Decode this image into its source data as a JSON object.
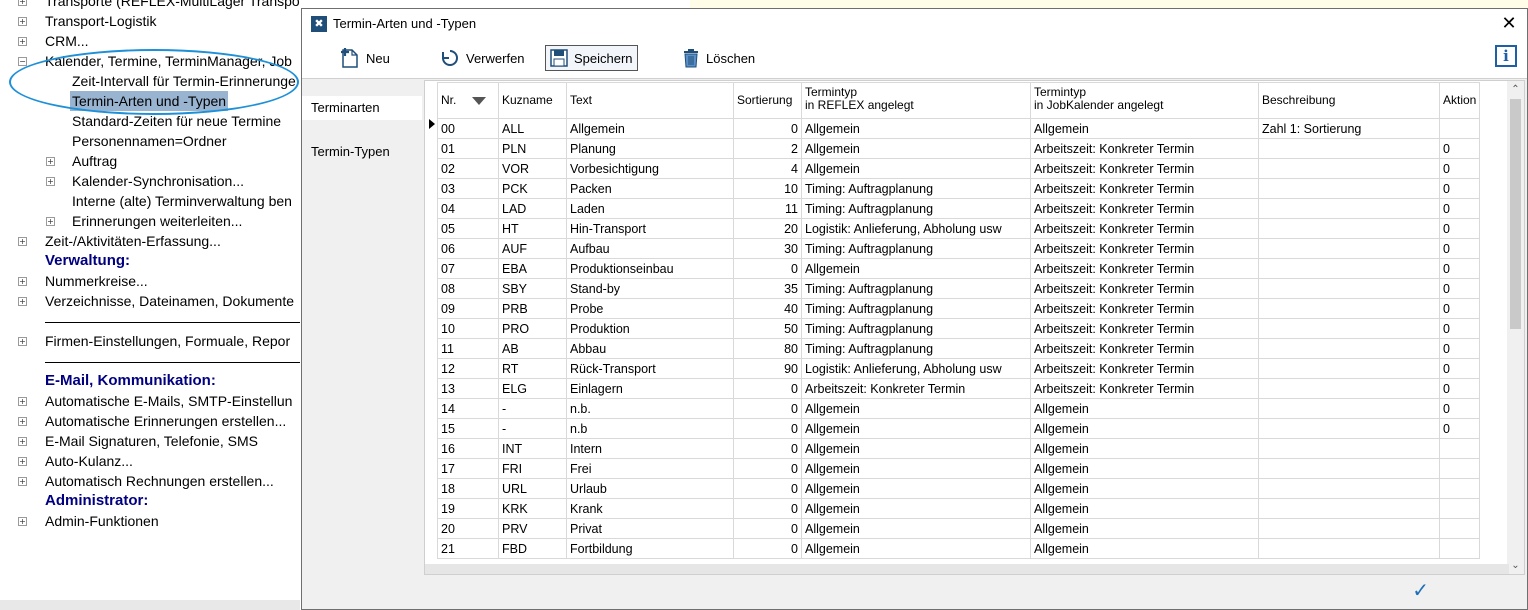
{
  "tree": {
    "items": [
      {
        "label": "Transporte (REFLEX-MultiLager Transporte)",
        "expander": "+"
      },
      {
        "label": "Transport-Logistik",
        "expander": "+"
      },
      {
        "label": "CRM...",
        "expander": "+"
      },
      {
        "label": "Kalender, Termine, TerminManager, Job",
        "expander": "−"
      },
      {
        "label": "Zeit-Intervall für Termin-Erinnerunge",
        "expander": ""
      },
      {
        "label": "Termin-Arten und -Typen",
        "expander": ""
      },
      {
        "label": "Standard-Zeiten für neue Termine",
        "expander": ""
      },
      {
        "label": "Personennamen=Ordner",
        "expander": ""
      },
      {
        "label": "Auftrag",
        "expander": "+"
      },
      {
        "label": "Kalender-Synchronisation...",
        "expander": "+"
      },
      {
        "label": "Interne (alte) Terminverwaltung ben",
        "expander": ""
      },
      {
        "label": "Erinnerungen weiterleiten...",
        "expander": "+"
      },
      {
        "label": "Zeit-/Aktivitäten-Erfassung...",
        "expander": "+"
      },
      {
        "label": "Verwaltung:",
        "expander": ""
      },
      {
        "label": "Nummerkreise...",
        "expander": "+"
      },
      {
        "label": "Verzeichnisse, Dateinamen, Dokumente",
        "expander": "+"
      },
      {
        "label": "Firmen-Einstellungen, Formuale, Repor",
        "expander": "+"
      },
      {
        "label": "E-Mail, Kommunikation:",
        "expander": ""
      },
      {
        "label": "Automatische E-Mails, SMTP-Einstellun",
        "expander": "+"
      },
      {
        "label": "Automatische Erinnerungen erstellen...",
        "expander": "+"
      },
      {
        "label": "E-Mail Signaturen, Telefonie, SMS",
        "expander": "+"
      },
      {
        "label": "Auto-Kulanz...",
        "expander": "+"
      },
      {
        "label": "Automatisch Rechnungen erstellen...",
        "expander": "+"
      },
      {
        "label": "Administrator:",
        "expander": ""
      },
      {
        "label": "Admin-Funktionen",
        "expander": "+"
      }
    ]
  },
  "dialog": {
    "title": "Termin-Arten und -Typen",
    "close_glyph": "✕",
    "app_icon_glyph": "✖",
    "info_glyph": "i",
    "ok_glyph": "✓",
    "toolbar": {
      "new_label": "Neu",
      "discard_label": "Verwerfen",
      "save_label": "Speichern",
      "delete_label": "Löschen"
    },
    "side_tabs": [
      "Terminarten",
      "Termin-Typen"
    ]
  },
  "grid": {
    "headers": {
      "nr": "Nr.",
      "kuzname": "Kuzname",
      "text": "Text",
      "sortierung": "Sortierung",
      "termintyp_reflex_1": "Termintyp",
      "termintyp_reflex_2": "in REFLEX angelegt",
      "termintyp_job_1": "Termintyp",
      "termintyp_job_2": "in JobKalender angelegt",
      "beschreibung": "Beschreibung",
      "aktion": "Aktion"
    },
    "rows": [
      {
        "nr": "00",
        "kuz": "ALL",
        "text": "Allgemein",
        "sort": "0",
        "reflex": "Allgemein",
        "job": "Allgemein",
        "beschr": "Zahl 1: Sortierung",
        "aktion": ""
      },
      {
        "nr": "01",
        "kuz": "PLN",
        "text": "Planung",
        "sort": "2",
        "reflex": "Allgemein",
        "job": "Arbeitszeit: Konkreter Termin",
        "beschr": "",
        "aktion": "0"
      },
      {
        "nr": "02",
        "kuz": "VOR",
        "text": "Vorbesichtigung",
        "sort": "4",
        "reflex": "Allgemein",
        "job": "Arbeitszeit: Konkreter Termin",
        "beschr": "",
        "aktion": "0"
      },
      {
        "nr": "03",
        "kuz": "PCK",
        "text": "Packen",
        "sort": "10",
        "reflex": "Timing: Auftragplanung",
        "job": "Arbeitszeit: Konkreter Termin",
        "beschr": "",
        "aktion": "0"
      },
      {
        "nr": "04",
        "kuz": "LAD",
        "text": "Laden",
        "sort": "11",
        "reflex": "Timing: Auftragplanung",
        "job": "Arbeitszeit: Konkreter Termin",
        "beschr": "",
        "aktion": "0"
      },
      {
        "nr": "05",
        "kuz": "HT",
        "text": "Hin-Transport",
        "sort": "20",
        "reflex": "Logistik: Anlieferung, Abholung usw",
        "job": "Arbeitszeit: Konkreter Termin",
        "beschr": "",
        "aktion": "0"
      },
      {
        "nr": "06",
        "kuz": "AUF",
        "text": "Aufbau",
        "sort": "30",
        "reflex": "Timing: Auftragplanung",
        "job": "Arbeitszeit: Konkreter Termin",
        "beschr": "",
        "aktion": "0"
      },
      {
        "nr": "07",
        "kuz": "EBA",
        "text": "Produktionseinbau",
        "sort": "0",
        "reflex": "Allgemein",
        "job": "Arbeitszeit: Konkreter Termin",
        "beschr": "",
        "aktion": "0"
      },
      {
        "nr": "08",
        "kuz": "SBY",
        "text": "Stand-by",
        "sort": "35",
        "reflex": "Timing: Auftragplanung",
        "job": "Arbeitszeit: Konkreter Termin",
        "beschr": "",
        "aktion": "0"
      },
      {
        "nr": "09",
        "kuz": "PRB",
        "text": "Probe",
        "sort": "40",
        "reflex": "Timing: Auftragplanung",
        "job": "Arbeitszeit: Konkreter Termin",
        "beschr": "",
        "aktion": "0"
      },
      {
        "nr": "10",
        "kuz": "PRO",
        "text": "Produktion",
        "sort": "50",
        "reflex": "Timing: Auftragplanung",
        "job": "Arbeitszeit: Konkreter Termin",
        "beschr": "",
        "aktion": "0"
      },
      {
        "nr": "11",
        "kuz": "AB",
        "text": "Abbau",
        "sort": "80",
        "reflex": "Timing: Auftragplanung",
        "job": "Arbeitszeit: Konkreter Termin",
        "beschr": "",
        "aktion": "0"
      },
      {
        "nr": "12",
        "kuz": "RT",
        "text": "Rück-Transport",
        "sort": "90",
        "reflex": "Logistik: Anlieferung, Abholung usw",
        "job": "Arbeitszeit: Konkreter Termin",
        "beschr": "",
        "aktion": "0"
      },
      {
        "nr": "13",
        "kuz": "ELG",
        "text": "Einlagern",
        "sort": "0",
        "reflex": "Arbeitszeit: Konkreter Termin",
        "job": "Arbeitszeit: Konkreter Termin",
        "beschr": "",
        "aktion": "0"
      },
      {
        "nr": "14",
        "kuz": "-",
        "text": "n.b.",
        "sort": "0",
        "reflex": "Allgemein",
        "job": "Allgemein",
        "beschr": "",
        "aktion": "0"
      },
      {
        "nr": "15",
        "kuz": "-",
        "text": "n.b",
        "sort": "0",
        "reflex": "Allgemein",
        "job": "Allgemein",
        "beschr": "",
        "aktion": "0"
      },
      {
        "nr": "16",
        "kuz": "INT",
        "text": "Intern",
        "sort": "0",
        "reflex": "Allgemein",
        "job": "Allgemein",
        "beschr": "",
        "aktion": ""
      },
      {
        "nr": "17",
        "kuz": "FRI",
        "text": "Frei",
        "sort": "0",
        "reflex": "Allgemein",
        "job": "Allgemein",
        "beschr": "",
        "aktion": ""
      },
      {
        "nr": "18",
        "kuz": "URL",
        "text": "Urlaub",
        "sort": "0",
        "reflex": "Allgemein",
        "job": "Allgemein",
        "beschr": "",
        "aktion": ""
      },
      {
        "nr": "19",
        "kuz": "KRK",
        "text": "Krank",
        "sort": "0",
        "reflex": "Allgemein",
        "job": "Allgemein",
        "beschr": "",
        "aktion": ""
      },
      {
        "nr": "20",
        "kuz": "PRV",
        "text": "Privat",
        "sort": "0",
        "reflex": "Allgemein",
        "job": "Allgemein",
        "beschr": "",
        "aktion": ""
      },
      {
        "nr": "21",
        "kuz": "FBD",
        "text": "Fortbildung",
        "sort": "0",
        "reflex": "Allgemein",
        "job": "Allgemein",
        "beschr": "",
        "aktion": ""
      }
    ]
  },
  "colors": {
    "accent": "#1e90d8",
    "selection": "#99b4d1",
    "section_heading": "#000080"
  }
}
